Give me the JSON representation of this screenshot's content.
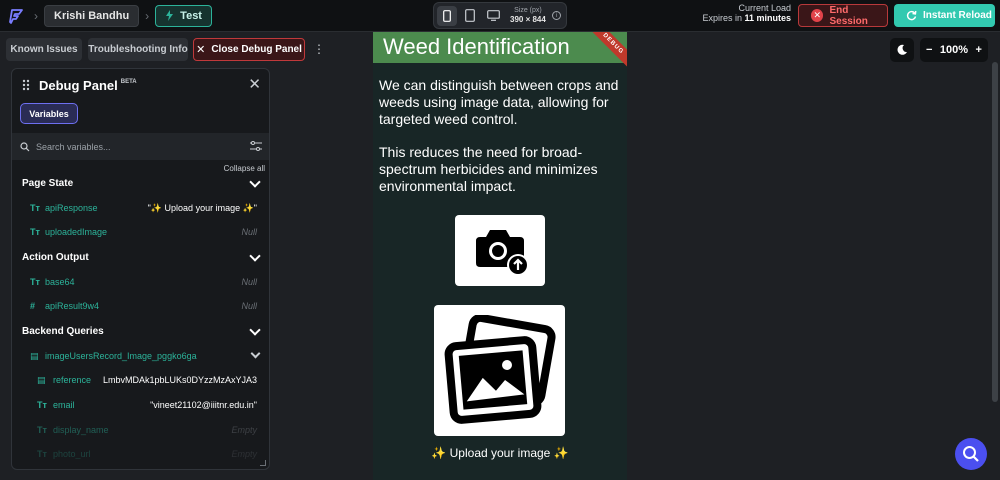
{
  "topbar": {
    "user_name": "Krishi Bandhu",
    "test_label": "Test",
    "size_label": "Size (px)",
    "size_value": "390 × 844",
    "current_load_label": "Current Load",
    "expires_prefix": "Expires in",
    "expires_value": "11 minutes",
    "end_session_label": "End Session",
    "instant_reload_label": "Instant Reload"
  },
  "toolbar": {
    "known_issues": "Known Issues",
    "troubleshooting": "Troubleshooting Info",
    "close_debug": "Close Debug Panel"
  },
  "debug_panel": {
    "title": "Debug Panel",
    "badge": "BETA",
    "tab_variables": "Variables",
    "search_placeholder": "Search variables...",
    "collapse_all": "Collapse all",
    "sections": {
      "page_state": "Page State",
      "action_output": "Action Output",
      "backend_queries": "Backend Queries"
    },
    "rows": {
      "api_response_name": "apiResponse",
      "api_response_value": "\"✨ Upload your image ✨\"",
      "uploaded_image_name": "uploadedImage",
      "uploaded_image_value": "Null",
      "base64_name": "base64",
      "base64_value": "Null",
      "api_result_name": "apiResult9w4",
      "api_result_value": "Null",
      "query_name": "imageUsersRecord_Image_pggko6ga",
      "reference_name": "reference",
      "reference_value": "LmbvMDAk1pbLUKs0DYzzMzAxYJA3",
      "email_name": "email",
      "email_value": "\"vineet21102@iiitnr.edu.in\"",
      "display_name_name": "display_name",
      "display_name_value": "Empty",
      "photo_url_name": "photo_url",
      "photo_url_value": "Empty"
    }
  },
  "phone": {
    "title": "Weed Identification",
    "ribbon": "DEBUG",
    "para1": "We can distinguish between crops and weeds using image data, allowing for targeted weed control.",
    "para2": "This reduces the need for broad-spectrum herbicides and minimizes environmental impact.",
    "upload_label": "✨ Upload your image ✨"
  },
  "zoom": {
    "value": "100%"
  },
  "colors": {
    "accent_teal": "#2cb39a",
    "end_session_red": "#e2434a",
    "app_bar_green": "#4c8b4e",
    "fab_purple": "#4b4ff0"
  }
}
